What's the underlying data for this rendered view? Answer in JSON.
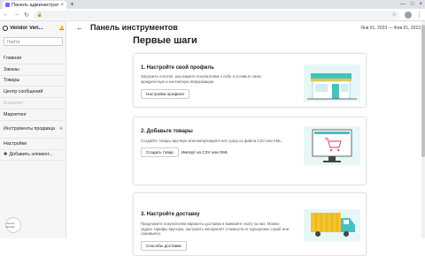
{
  "browser": {
    "tab_title": "Панель администратора",
    "tab_close": "×",
    "new_tab": "+",
    "url": "",
    "controls": [
      "—",
      "□",
      "×"
    ]
  },
  "sidebar": {
    "vendor_name": "Vendor Ven...",
    "search_placeholder": "Найти",
    "items": [
      {
        "label": "Главная",
        "disabled": false
      },
      {
        "label": "Заказы",
        "disabled": false
      },
      {
        "label": "Товары",
        "disabled": false
      },
      {
        "label": "Центр сообщений",
        "disabled": false
      },
      {
        "label": "Кошелек",
        "disabled": true
      },
      {
        "label": "Маркетинг",
        "disabled": false
      },
      {
        "label": "Инструменты продавца",
        "disabled": false
      },
      {
        "label": "Настройки",
        "disabled": false
      },
      {
        "label": "Добавить элемент...",
        "disabled": false
      }
    ],
    "badge_text": "Vendor Rocket"
  },
  "header": {
    "back": "←",
    "title": "Панель инструментов",
    "date_range": "Янв 01, 2023 — Фев 01, 2023",
    "subtitle": "Первые шаги"
  },
  "cards": [
    {
      "title": "1. Настройте свой профиль",
      "desc": "Загрузите логотип, расскажите покупателям о себе и оставьте свою юридическую и контактную информацию.",
      "button": "Настройки профиля"
    },
    {
      "title": "2. Добавьте товары",
      "desc": "Создайте товары вручную или импортируйте все сразу из файла CSV или XML.",
      "button": "Создать товар",
      "link": "Импорт из CSV или XML"
    },
    {
      "title": "3. Настройте доставку",
      "desc": "Предложите покупателям варианты доставки и взимайте плату за них. Можно задать тарифы вручную, настроить автораcчёт стоимости от курьерских служб или самовывоз.",
      "button": "Способы доставки"
    }
  ],
  "colors": {
    "accent_teal": "#47c1bf",
    "accent_yellow": "#f4c430",
    "illus_bg": "#e6f7f6",
    "sidebar_bg": "#f6f6f7"
  }
}
